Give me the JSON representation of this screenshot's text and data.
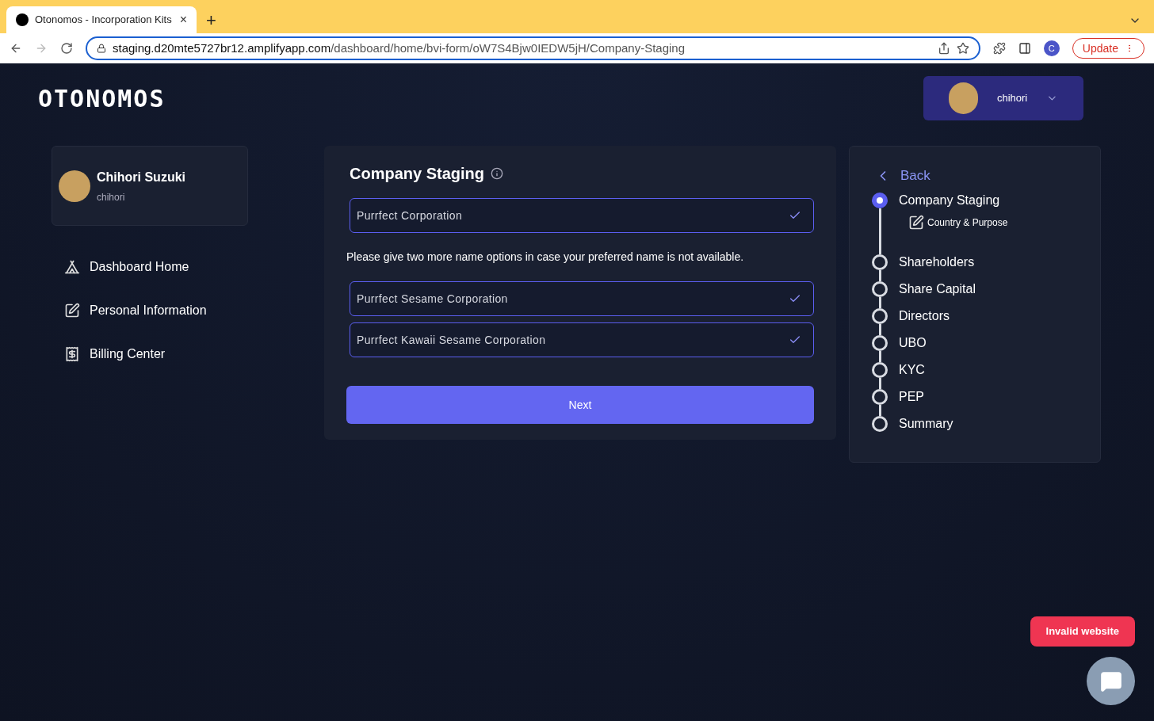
{
  "browser": {
    "tab_title": "Otonomos - Incorporation Kits",
    "tab_close": "×",
    "new_tab": "+",
    "url_host": "staging.d20mte5727br12.amplifyapp.com",
    "url_path": "/dashboard/home/bvi-form/oW7S4Bjw0IEDW5jH/Company-Staging",
    "profile_initial": "C",
    "update_button": "Update"
  },
  "header": {
    "logo": "OTONOMOS",
    "user_menu": {
      "username": "chihori"
    }
  },
  "profile": {
    "name": "Chihori Suzuki",
    "username": "chihori"
  },
  "sidebar": {
    "items": [
      {
        "label": "Dashboard Home",
        "kind": "home"
      },
      {
        "label": "Personal Information",
        "kind": "edit"
      },
      {
        "label": "Billing Center",
        "kind": "billing"
      }
    ]
  },
  "form": {
    "title": "Company Staging",
    "preferred_name": {
      "value": "Purrfect Corporation",
      "valid": true
    },
    "instruction": "Please give two more name options in case your preferred name is not available.",
    "alternatives": [
      {
        "value": "Purrfect Sesame Corporation",
        "valid": true
      },
      {
        "value": "Purrfect Kawaii Sesame Corporation",
        "valid": true
      }
    ],
    "next_button": "Next"
  },
  "stepper": {
    "back": "Back",
    "steps": [
      {
        "label": "Company Staging",
        "selected": true,
        "children": [
          {
            "label": "Country & Purpose"
          }
        ]
      },
      {
        "label": "Shareholders",
        "selected": false
      },
      {
        "label": "Share Capital",
        "selected": false
      },
      {
        "label": "Directors",
        "selected": false
      },
      {
        "label": "UBO",
        "selected": false
      },
      {
        "label": "KYC",
        "selected": false
      },
      {
        "label": "PEP",
        "selected": false
      },
      {
        "label": "Summary",
        "selected": false
      }
    ]
  },
  "alert": {
    "text": "Invalid website"
  }
}
